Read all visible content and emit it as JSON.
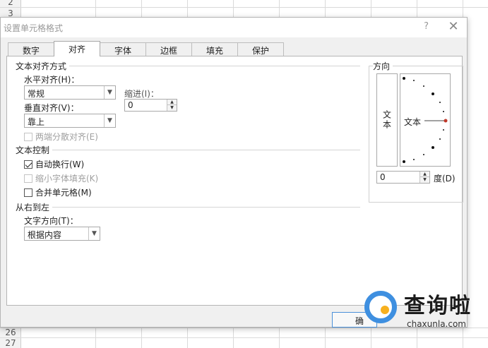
{
  "sheet": {
    "row_numbers": [
      "2",
      "3",
      "26",
      "27"
    ]
  },
  "dialog": {
    "title": "设置单元格格式",
    "help": "?",
    "close": "✕",
    "tabs": [
      {
        "label": "数字"
      },
      {
        "label": "对齐"
      },
      {
        "label": "字体"
      },
      {
        "label": "边框"
      },
      {
        "label": "填充"
      },
      {
        "label": "保护"
      }
    ],
    "active_tab": "对齐",
    "text_alignment": {
      "group_label": "文本对齐方式",
      "horizontal_label": "水平对齐(H)：",
      "horizontal_value": "常规",
      "indent_label": "缩进(I)：",
      "indent_value": "0",
      "vertical_label": "垂直对齐(V)：",
      "vertical_value": "靠上",
      "distributed_label": "两端分散对齐(E)"
    },
    "text_control": {
      "group_label": "文本控制",
      "wrap_label": "自动换行(W)",
      "wrap_checked": true,
      "shrink_label": "缩小字体填充(K)",
      "merge_label": "合并单元格(M)"
    },
    "rtl": {
      "group_label": "从右到左",
      "direction_label": "文字方向(T)：",
      "direction_value": "根据内容"
    },
    "orientation": {
      "group_label": "方向",
      "vertical_text": "文本",
      "dial_text": "文本",
      "degrees_value": "0",
      "degrees_label": "度(D)"
    },
    "ok_button": "确"
  },
  "watermark": {
    "cn": "查询啦",
    "en": "chaxunla.com"
  },
  "colors": {
    "accent": "#3e8fe0",
    "dial_red": "#c0392b"
  }
}
